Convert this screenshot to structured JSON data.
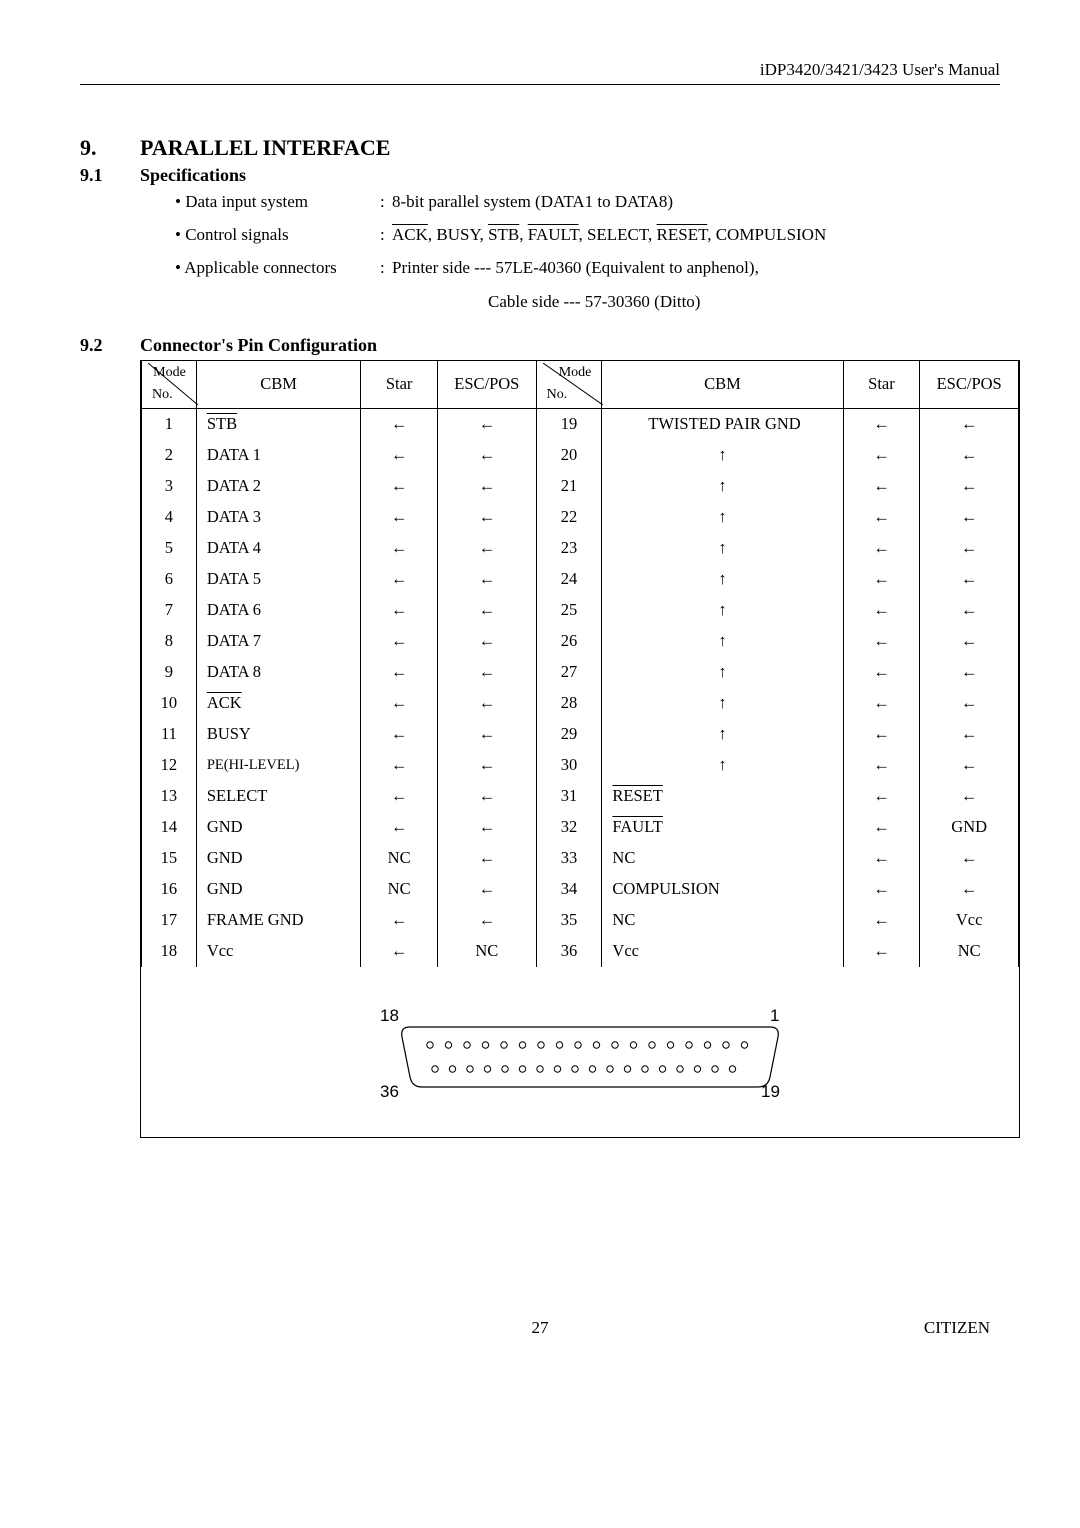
{
  "header": {
    "title": "iDP3420/3421/3423 User's Manual"
  },
  "section": {
    "num": "9.",
    "title": "PARALLEL INTERFACE"
  },
  "sub1": {
    "num": "9.1",
    "title": "Specifications",
    "items": {
      "dis_label": "• Data input system",
      "dis_value": "8-bit parallel system (DATA1 to DATA8)",
      "cs_label": "• Control signals",
      "cs_prefix": " ",
      "cs_ack": "ACK",
      "cs_busy": ", BUSY, ",
      "cs_stb": "STB",
      "cs_fault": ", ",
      "cs_fault_ov": "FAULT",
      "cs_select": ", SELECT, ",
      "cs_reset": "RESET",
      "cs_tail": ", COMPULSION",
      "ac_label": "• Applicable connectors",
      "ac_printer": "Printer side   --- 57LE-40360 (Equivalent to anphenol),",
      "ac_cable": "Cable side      --- 57-30360 (Ditto)"
    }
  },
  "sub2": {
    "num": "9.2",
    "title": "Connector's Pin Configuration"
  },
  "th": {
    "mode": "Mode",
    "no": "No.",
    "cbm": "CBM",
    "star": "Star",
    "esc": "ESC/POS"
  },
  "rows_left": [
    {
      "no": "1",
      "cbm": "STB",
      "ov": true,
      "star": "←",
      "esc": "←"
    },
    {
      "no": "2",
      "cbm": "DATA 1",
      "ov": false,
      "star": "←",
      "esc": "←"
    },
    {
      "no": "3",
      "cbm": "DATA 2",
      "ov": false,
      "star": "←",
      "esc": "←"
    },
    {
      "no": "4",
      "cbm": "DATA 3",
      "ov": false,
      "star": "←",
      "esc": "←"
    },
    {
      "no": "5",
      "cbm": "DATA 4",
      "ov": false,
      "star": "←",
      "esc": "←"
    },
    {
      "no": "6",
      "cbm": "DATA 5",
      "ov": false,
      "star": "←",
      "esc": "←"
    },
    {
      "no": "7",
      "cbm": "DATA 6",
      "ov": false,
      "star": "←",
      "esc": "←"
    },
    {
      "no": "8",
      "cbm": "DATA 7",
      "ov": false,
      "star": "←",
      "esc": "←"
    },
    {
      "no": "9",
      "cbm": "DATA 8",
      "ov": false,
      "star": "←",
      "esc": "←"
    },
    {
      "no": "10",
      "cbm": "ACK",
      "ov": true,
      "star": "←",
      "esc": "←"
    },
    {
      "no": "11",
      "cbm": "BUSY",
      "ov": false,
      "star": "←",
      "esc": "←"
    },
    {
      "no": "12",
      "cbm": "PE(HI-LEVEL)",
      "ov": false,
      "star": "←",
      "esc": "←",
      "small": true
    },
    {
      "no": "13",
      "cbm": "SELECT",
      "ov": false,
      "star": "←",
      "esc": "←"
    },
    {
      "no": "14",
      "cbm": "GND",
      "ov": false,
      "star": "←",
      "esc": "←"
    },
    {
      "no": "15",
      "cbm": "GND",
      "ov": false,
      "star": "NC",
      "esc": "←"
    },
    {
      "no": "16",
      "cbm": "GND",
      "ov": false,
      "star": "NC",
      "esc": "←"
    },
    {
      "no": "17",
      "cbm": "FRAME GND",
      "ov": false,
      "star": "←",
      "esc": "←"
    },
    {
      "no": "18",
      "cbm": "Vcc",
      "ov": false,
      "star": "←",
      "esc": "NC"
    }
  ],
  "rows_right": [
    {
      "no": "19",
      "cbm": "TWISTED PAIR GND",
      "ov": false,
      "star": "←",
      "esc": "←"
    },
    {
      "no": "20",
      "cbm": "↑",
      "ov": false,
      "star": "←",
      "esc": "←"
    },
    {
      "no": "21",
      "cbm": "↑",
      "ov": false,
      "star": "←",
      "esc": "←"
    },
    {
      "no": "22",
      "cbm": "↑",
      "ov": false,
      "star": "←",
      "esc": "←"
    },
    {
      "no": "23",
      "cbm": "↑",
      "ov": false,
      "star": "←",
      "esc": "←"
    },
    {
      "no": "24",
      "cbm": "↑",
      "ov": false,
      "star": "←",
      "esc": "←"
    },
    {
      "no": "25",
      "cbm": "↑",
      "ov": false,
      "star": "←",
      "esc": "←"
    },
    {
      "no": "26",
      "cbm": "↑",
      "ov": false,
      "star": "←",
      "esc": "←"
    },
    {
      "no": "27",
      "cbm": "↑",
      "ov": false,
      "star": "←",
      "esc": "←"
    },
    {
      "no": "28",
      "cbm": "↑",
      "ov": false,
      "star": "←",
      "esc": "←"
    },
    {
      "no": "29",
      "cbm": "↑",
      "ov": false,
      "star": "←",
      "esc": "←"
    },
    {
      "no": "30",
      "cbm": "↑",
      "ov": false,
      "star": "←",
      "esc": "←"
    },
    {
      "no": "31",
      "cbm": "RESET",
      "ov": true,
      "star": "←",
      "esc": "←"
    },
    {
      "no": "32",
      "cbm": "FAULT",
      "ov": true,
      "star": "←",
      "esc": "GND"
    },
    {
      "no": "33",
      "cbm": "NC",
      "ov": false,
      "star": "←",
      "esc": "←"
    },
    {
      "no": "34",
      "cbm": "COMPULSION",
      "ov": false,
      "star": "←",
      "esc": "←"
    },
    {
      "no": "35",
      "cbm": "NC",
      "ov": false,
      "star": "←",
      "esc": "Vcc"
    },
    {
      "no": "36",
      "cbm": "Vcc",
      "ov": false,
      "star": "←",
      "esc": "NC"
    }
  ],
  "diagram": {
    "tl": "18",
    "tr": "1",
    "bl": "36",
    "br": "19"
  },
  "footer": {
    "page": "27",
    "brand": "CITIZEN"
  },
  "chart_data": {
    "type": "table",
    "title": "Connector's Pin Configuration",
    "columns": [
      "No.",
      "CBM",
      "Star",
      "ESC/POS"
    ],
    "data": [
      [
        1,
        "STB (active-low)",
        "←",
        "←"
      ],
      [
        2,
        "DATA 1",
        "←",
        "←"
      ],
      [
        3,
        "DATA 2",
        "←",
        "←"
      ],
      [
        4,
        "DATA 3",
        "←",
        "←"
      ],
      [
        5,
        "DATA 4",
        "←",
        "←"
      ],
      [
        6,
        "DATA 5",
        "←",
        "←"
      ],
      [
        7,
        "DATA 6",
        "←",
        "←"
      ],
      [
        8,
        "DATA 7",
        "←",
        "←"
      ],
      [
        9,
        "DATA 8",
        "←",
        "←"
      ],
      [
        10,
        "ACK (active-low)",
        "←",
        "←"
      ],
      [
        11,
        "BUSY",
        "←",
        "←"
      ],
      [
        12,
        "PE(HI-LEVEL)",
        "←",
        "←"
      ],
      [
        13,
        "SELECT",
        "←",
        "←"
      ],
      [
        14,
        "GND",
        "←",
        "←"
      ],
      [
        15,
        "GND",
        "NC",
        "←"
      ],
      [
        16,
        "GND",
        "NC",
        "←"
      ],
      [
        17,
        "FRAME GND",
        "←",
        "←"
      ],
      [
        18,
        "Vcc",
        "←",
        "NC"
      ],
      [
        19,
        "TWISTED PAIR GND",
        "←",
        "←"
      ],
      [
        20,
        "↑",
        "←",
        "←"
      ],
      [
        21,
        "↑",
        "←",
        "←"
      ],
      [
        22,
        "↑",
        "←",
        "←"
      ],
      [
        23,
        "↑",
        "←",
        "←"
      ],
      [
        24,
        "↑",
        "←",
        "←"
      ],
      [
        25,
        "↑",
        "←",
        "←"
      ],
      [
        26,
        "↑",
        "←",
        "←"
      ],
      [
        27,
        "↑",
        "←",
        "←"
      ],
      [
        28,
        "↑",
        "←",
        "←"
      ],
      [
        29,
        "↑",
        "←",
        "←"
      ],
      [
        30,
        "↑",
        "←",
        "←"
      ],
      [
        31,
        "RESET (active-low)",
        "←",
        "←"
      ],
      [
        32,
        "FAULT (active-low)",
        "←",
        "GND"
      ],
      [
        33,
        "NC",
        "←",
        "←"
      ],
      [
        34,
        "COMPULSION",
        "←",
        "←"
      ],
      [
        35,
        "NC",
        "←",
        "Vcc"
      ],
      [
        36,
        "Vcc",
        "←",
        "NC"
      ]
    ]
  }
}
